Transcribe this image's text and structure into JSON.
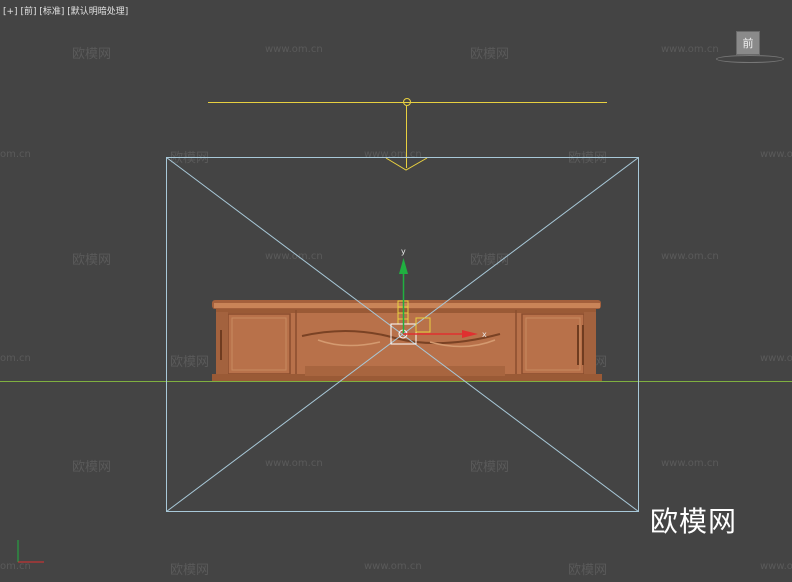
{
  "viewport": {
    "label_parts": [
      "[+]",
      "[前]",
      "[标准]",
      "[默认明暗处理]"
    ]
  },
  "viewcube": {
    "face_label": "前"
  },
  "gizmo": {
    "x_label": "x",
    "y_label": "y"
  },
  "watermark": {
    "logo_text": "欧模网",
    "site_text": "www.om.cn",
    "site_partial": "om.cn",
    "big_text": "欧模网"
  },
  "colors": {
    "background": "#444444",
    "camera_frustum": "#a8c8d8",
    "target_yellow": "#e8d040",
    "ground_line": "#7fb040",
    "furniture_wood": "#b8714a",
    "axis_x": "#e03030",
    "axis_y": "#20b040"
  }
}
